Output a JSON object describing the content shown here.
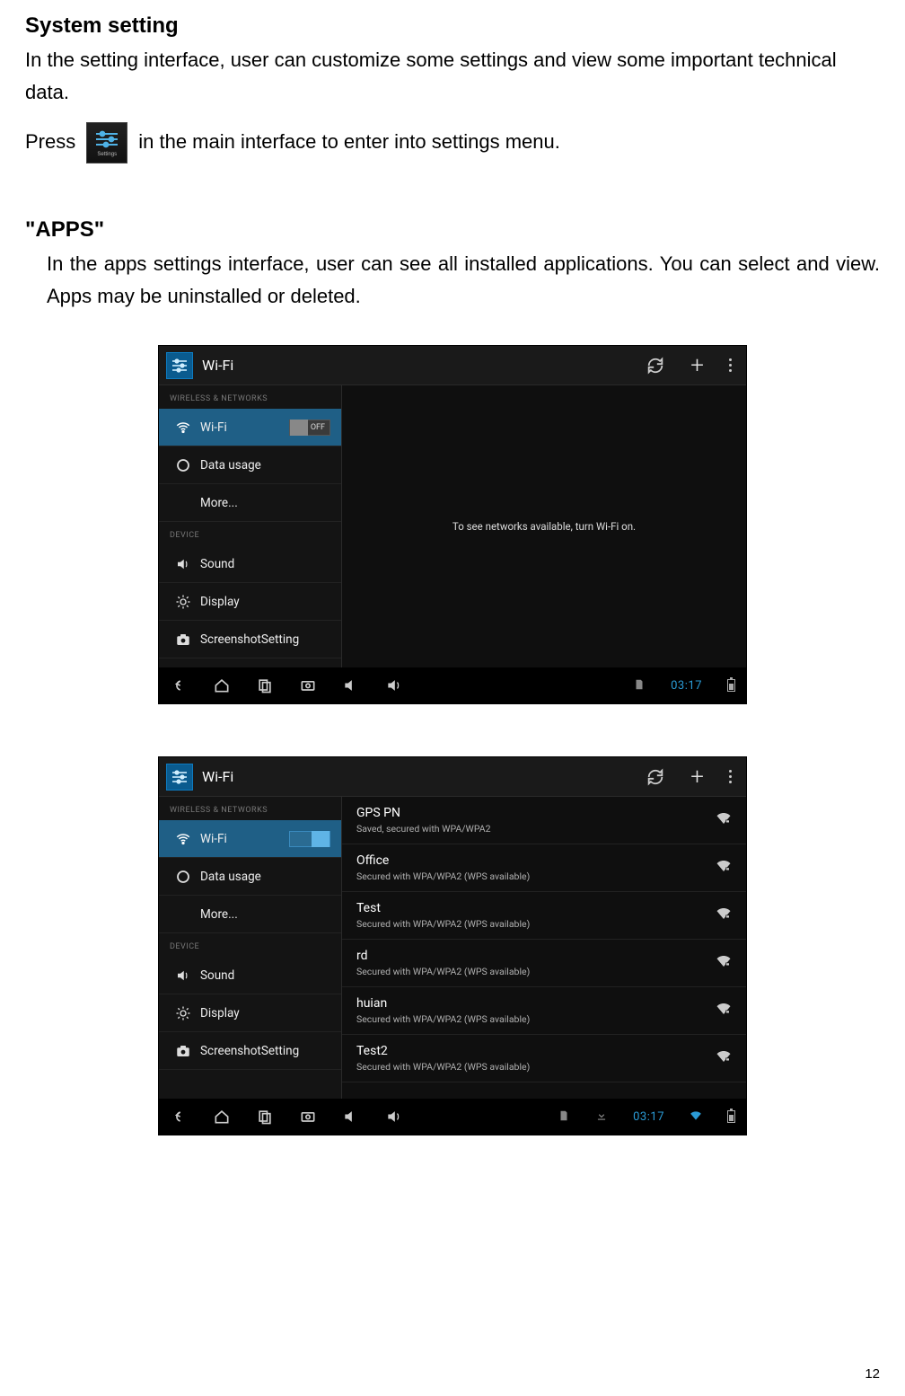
{
  "doc": {
    "h1": "System setting",
    "intro": "In the setting interface, user can customize some settings and view some important technical data.",
    "press_before": "Press",
    "press_after": "in the main interface to enter into settings menu.",
    "settings_tile_label": "Settings",
    "h2": "\"APPS\"",
    "apps_para": "In the apps settings interface, user can see all installed applications. You can select and view. Apps may be uninstalled or deleted.",
    "page_number": "12"
  },
  "shot1": {
    "title": "Wi-Fi",
    "wifi_state": "OFF",
    "content_msg": "To see networks available, turn Wi-Fi on.",
    "clock": "03:17"
  },
  "shot2": {
    "title": "Wi-Fi",
    "wifi_state": "ON",
    "clock": "03:17",
    "networks": [
      {
        "name": "GPS PN",
        "sub": "Saved, secured with WPA/WPA2"
      },
      {
        "name": "Office",
        "sub": "Secured with WPA/WPA2 (WPS available)"
      },
      {
        "name": "Test",
        "sub": "Secured with WPA/WPA2 (WPS available)"
      },
      {
        "name": "rd",
        "sub": "Secured with WPA/WPA2 (WPS available)"
      },
      {
        "name": "huian",
        "sub": "Secured with WPA/WPA2 (WPS available)"
      },
      {
        "name": "Test2",
        "sub": "Secured with WPA/WPA2 (WPS available)"
      }
    ]
  },
  "side": {
    "sec_wireless": "WIRELESS & NETWORKS",
    "sec_device": "DEVICE",
    "wifi": "Wi-Fi",
    "data": "Data usage",
    "more": "More...",
    "sound": "Sound",
    "display": "Display",
    "screenshot": "ScreenshotSetting"
  }
}
